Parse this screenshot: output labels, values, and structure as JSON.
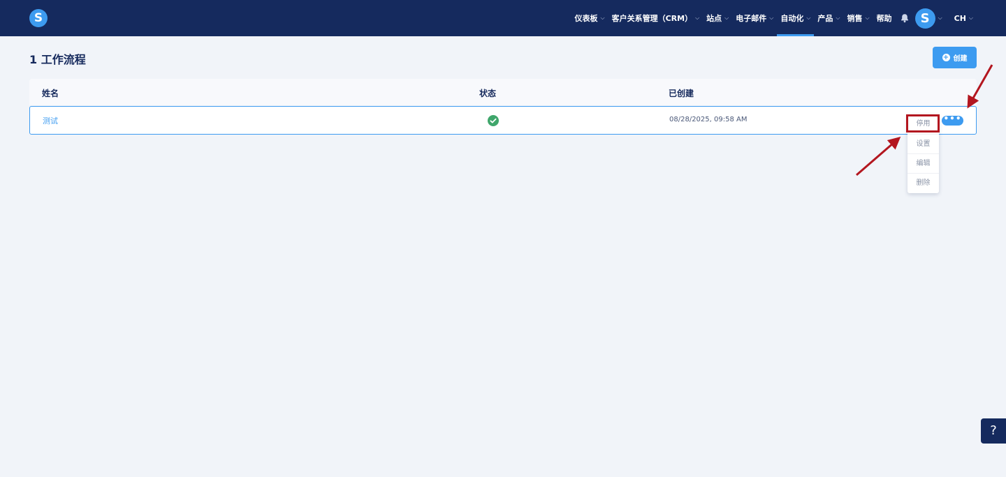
{
  "nav": {
    "logo_letter": "S",
    "items": [
      {
        "label": "仪表板",
        "chevron": "⌵"
      },
      {
        "label": "客户关系管理（CRM）",
        "chevron": "⌵"
      },
      {
        "label": "站点",
        "chevron": "⌵"
      },
      {
        "label": "电子邮件",
        "chevron": "⌵"
      },
      {
        "label": "自动化",
        "chevron": "⌵"
      },
      {
        "label": "产品",
        "chevron": "⌵"
      },
      {
        "label": "销售",
        "chevron": "⌵"
      },
      {
        "label": "帮助"
      }
    ],
    "active_item": "自动化",
    "avatar_letter": "S",
    "language": "CH",
    "chevron": "⌵"
  },
  "page": {
    "title": "1 工作流程",
    "create_label": "创建",
    "create_icon": "+"
  },
  "table": {
    "columns": {
      "name": "姓名",
      "status": "状态",
      "created": "已创建"
    },
    "rows": [
      {
        "name": "测试",
        "status": "active",
        "created": "08/28/2025, 09:58 AM"
      }
    ],
    "more_label": "•••"
  },
  "menu": {
    "items": [
      "停用",
      "设置",
      "编辑",
      "删除"
    ],
    "highlighted": "停用"
  },
  "help": {
    "label": "?"
  },
  "colors": {
    "topbar": "#152a5e",
    "accent": "#3d9bf0",
    "success": "#3fa66b",
    "annotation": "#b3161f",
    "background": "#f1f4f9"
  }
}
